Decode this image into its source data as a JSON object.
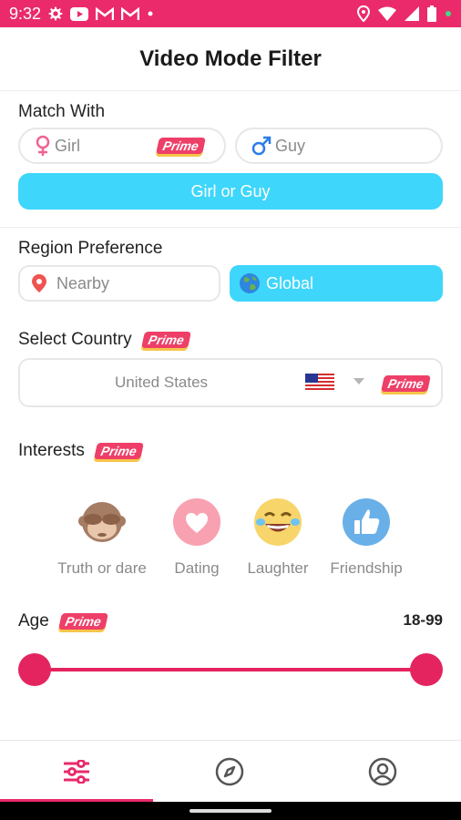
{
  "status_bar": {
    "time": "9:32",
    "left_icons": [
      "gear-icon",
      "youtube-icon",
      "gmail-icon",
      "gmail-icon",
      "dot-icon"
    ],
    "right_icons": [
      "location-icon",
      "wifi-icon",
      "signal-icon",
      "battery-icon",
      "green-dot-icon"
    ]
  },
  "header": {
    "title": "Video Mode Filter"
  },
  "match_with": {
    "label": "Match With",
    "girl": "Girl",
    "guy": "Guy",
    "prime_badge": "Prime",
    "primary_button": "Girl or Guy"
  },
  "region": {
    "label": "Region Preference",
    "nearby": "Nearby",
    "global": "Global"
  },
  "country": {
    "label": "Select Country",
    "prime_badge": "Prime",
    "selected": "United States",
    "box_prime_badge": "Prime"
  },
  "interests": {
    "label": "Interests",
    "prime_badge": "Prime",
    "items": [
      {
        "label": "Truth or dare",
        "icon": "monkey-icon"
      },
      {
        "label": "Dating",
        "icon": "heart-icon"
      },
      {
        "label": "Laughter",
        "icon": "laughing-face-icon"
      },
      {
        "label": "Friendship",
        "icon": "thumbs-up-icon"
      }
    ]
  },
  "age": {
    "label": "Age",
    "prime_badge": "Prime",
    "value": "18-99",
    "min": 18,
    "max": 99,
    "range_low": 18,
    "range_high": 99
  },
  "bottom_nav": {
    "items": [
      {
        "icon": "filter-sliders-icon",
        "active": true
      },
      {
        "icon": "compass-icon",
        "active": false
      },
      {
        "icon": "profile-icon",
        "active": false
      }
    ]
  },
  "colors": {
    "accent": "#ea2a6a",
    "cyan": "#3ed6fb",
    "prime": "#ee3f68",
    "muted": "#8a8a8a"
  }
}
